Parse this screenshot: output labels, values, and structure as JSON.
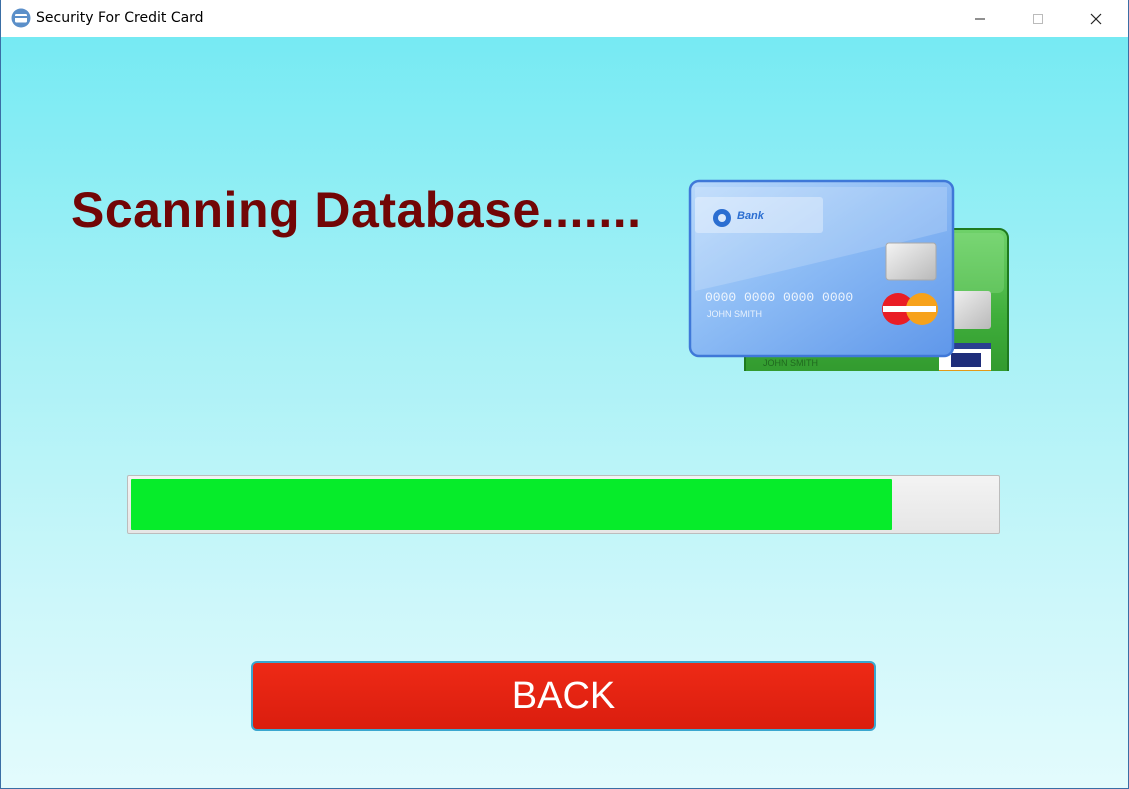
{
  "window": {
    "title": "Security For Credit Card",
    "icon": "credit-card-icon",
    "controls": [
      "minimize-icon",
      "maximize-icon",
      "close-icon"
    ]
  },
  "main": {
    "heading": "Scanning Database.......",
    "heading_color": "#720606",
    "progress": {
      "value_percent": 88,
      "fill_color": "#06ec2a"
    },
    "back_button": {
      "label": "BACK",
      "color": "#e42414"
    },
    "illustration": {
      "name": "credit-cards-icon",
      "front_card": {
        "bank": "Bank",
        "number": "0000 0000 0000 0000",
        "holder": "JOHN SMITH"
      },
      "back_card": {
        "holder": "JOHN SMITH"
      }
    }
  }
}
